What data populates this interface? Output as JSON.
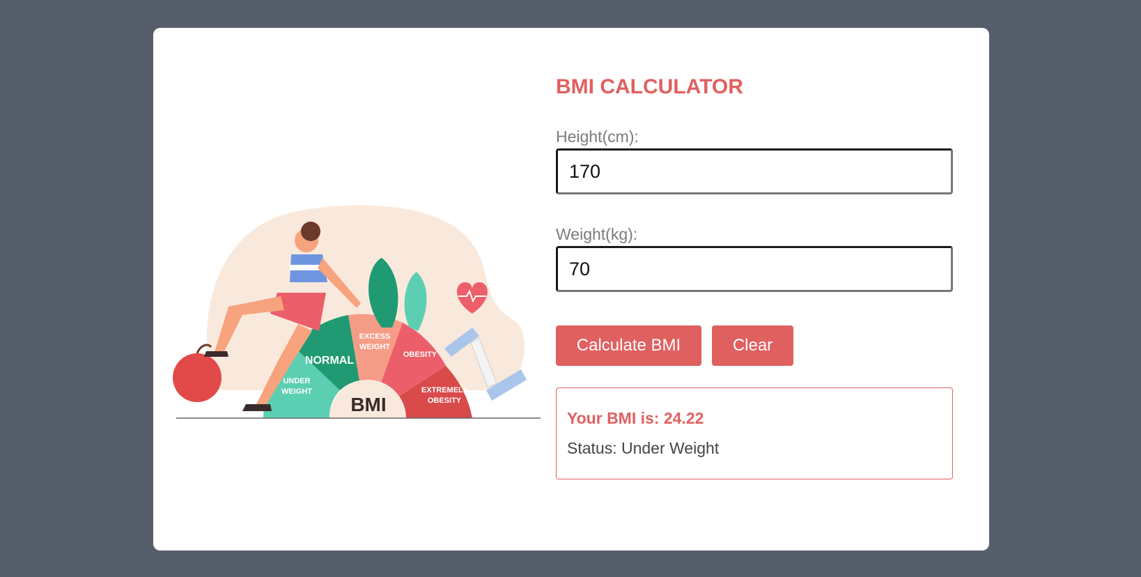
{
  "calculator": {
    "title": "BMI CALCULATOR",
    "height_label": "Height(cm):",
    "height_value": "170",
    "weight_label": "Weight(kg):",
    "weight_value": "70",
    "calculate_label": "Calculate BMI",
    "clear_label": "Clear"
  },
  "result": {
    "bmi_text": "Your BMI is: 24.22",
    "status_text": "Status: Under Weight"
  },
  "illustration": {
    "gauge_labels": {
      "under_weight": [
        "UNDER",
        "WEIGHT"
      ],
      "normal": "NORMAL",
      "excess_weight": [
        "EXCESS",
        "WEIGHT"
      ],
      "obesity": "OBESITY",
      "extremely_obesity": [
        "EXTREMELY",
        "OBESITY"
      ],
      "center": "BMI"
    }
  },
  "colors": {
    "accent": "#e06060",
    "page_background": "#575e6b",
    "card_background": "#ffffff"
  }
}
